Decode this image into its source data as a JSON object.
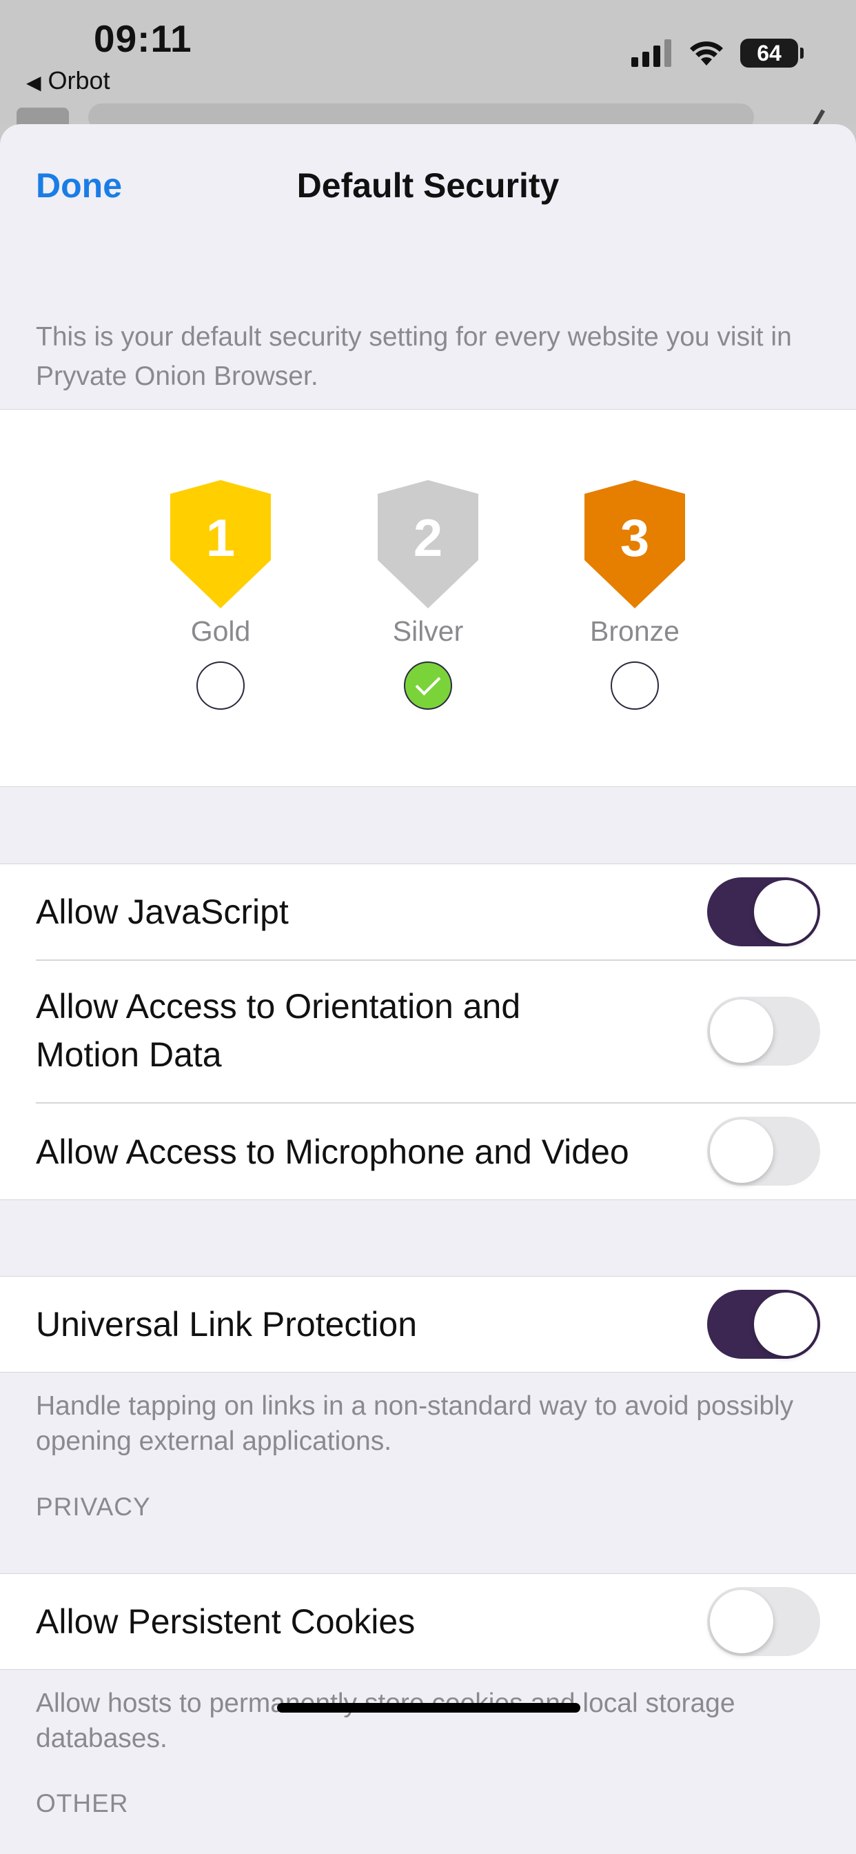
{
  "status_bar": {
    "time": "09:11",
    "back_app": "Orbot",
    "battery": "64",
    "icons": [
      "cellular-signal-icon",
      "wifi-icon",
      "battery-icon"
    ]
  },
  "nav": {
    "done_label": "Done",
    "title": "Default Security"
  },
  "description": "This is your default security setting for every website you visit in Pryvate Onion Browser.",
  "security_levels": [
    {
      "number": "1",
      "label": "Gold",
      "color": "#FFCF00",
      "selected": false
    },
    {
      "number": "2",
      "label": "Silver",
      "color": "#CCCCCC",
      "selected": true
    },
    {
      "number": "3",
      "label": "Bronze",
      "color": "#E67E00",
      "selected": false
    }
  ],
  "permissions": [
    {
      "label": "Allow JavaScript",
      "on": true
    },
    {
      "label": "Allow Access to Orientation and Motion Data",
      "on": false
    },
    {
      "label": "Allow Access to Microphone and Video",
      "on": false
    }
  ],
  "universal_link": {
    "label": "Universal Link Protection",
    "on": true,
    "footer": "Handle tapping on links in a non-standard way to avoid possibly opening external applications."
  },
  "privacy": {
    "header": "PRIVACY",
    "persistent_cookies_label": "Allow Persistent Cookies",
    "persistent_cookies_on": false,
    "footer": "Allow hosts to permanently store cookies and local storage databases."
  },
  "other_header": "OTHER",
  "colors": {
    "accent_blue": "#1A7DE6",
    "toggle_on": "#3B2752",
    "check_green": "#7BD33A"
  }
}
